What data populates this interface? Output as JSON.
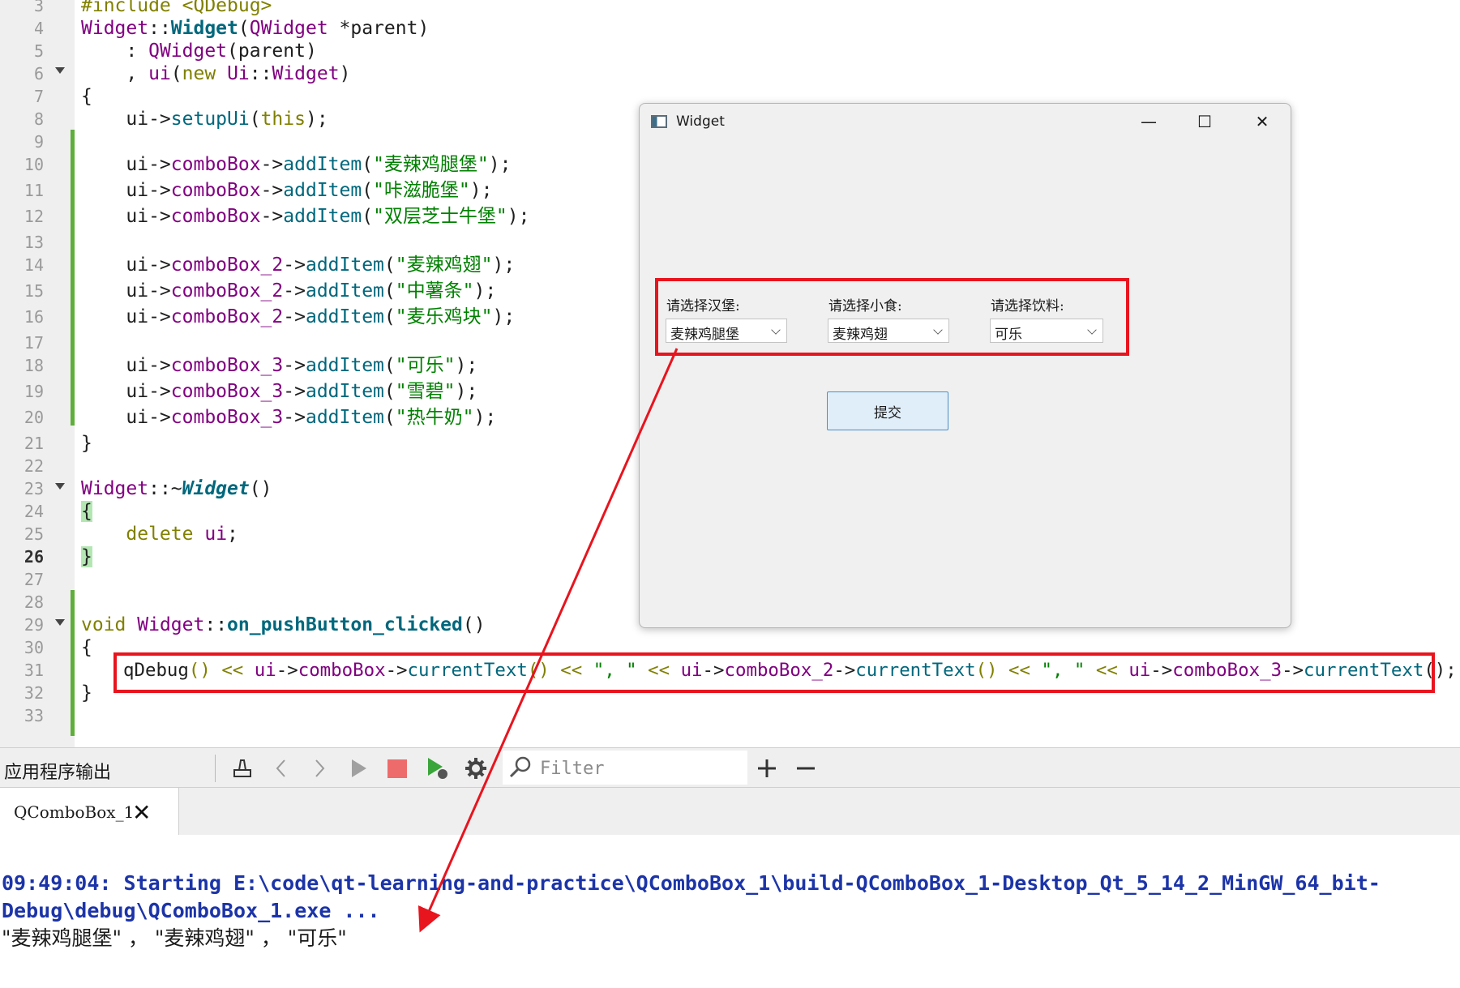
{
  "editor": {
    "line_numbers": [
      "3",
      "4",
      "5",
      "6",
      "7",
      "8",
      "9",
      "10",
      "11",
      "12",
      "13",
      "14",
      "15",
      "16",
      "17",
      "18",
      "19",
      "20",
      "21",
      "22",
      "23",
      "24",
      "25",
      "26",
      "27",
      "28",
      "29",
      "30",
      "31",
      "32",
      "33"
    ],
    "current_line": "26",
    "code": {
      "l3": "#include <QDebug>",
      "l4_a": "Widget",
      "l4_b": "::",
      "l4_c": "Widget",
      "l4_d": "(",
      "l4_e": "QWidget",
      "l4_f": " *parent)",
      "l5_a": "    : ",
      "l5_b": "QWidget",
      "l5_c": "(parent)",
      "l6_a": "    , ",
      "l6_b": "ui",
      "l6_c": "(",
      "l6_d": "new",
      "l6_e": " ",
      "l6_f": "Ui",
      "l6_g": "::",
      "l6_h": "Widget",
      "l6_i": ")",
      "l7": "{",
      "l8_a": "    ui->",
      "l8_b": "setupUi",
      "l8_c": "(",
      "l8_d": "this",
      "l8_e": ");",
      "l10_a": "    ui->",
      "l10_b": "comboBox",
      "l10_c": "->",
      "l10_d": "addItem",
      "l10_e": "(",
      "l10_f": "\"麦辣鸡腿堡\"",
      "l10_g": ");",
      "l11_a": "    ui->",
      "l11_b": "comboBox",
      "l11_c": "->",
      "l11_d": "addItem",
      "l11_e": "(",
      "l11_f": "\"咔滋脆堡\"",
      "l11_g": ");",
      "l12_a": "    ui->",
      "l12_b": "comboBox",
      "l12_c": "->",
      "l12_d": "addItem",
      "l12_e": "(",
      "l12_f": "\"双层芝士牛堡\"",
      "l12_g": ");",
      "l14_a": "    ui->",
      "l14_b": "comboBox_2",
      "l14_c": "->",
      "l14_d": "addItem",
      "l14_e": "(",
      "l14_f": "\"麦辣鸡翅\"",
      "l14_g": ");",
      "l15_a": "    ui->",
      "l15_b": "comboBox_2",
      "l15_c": "->",
      "l15_d": "addItem",
      "l15_e": "(",
      "l15_f": "\"中薯条\"",
      "l15_g": ");",
      "l16_a": "    ui->",
      "l16_b": "comboBox_2",
      "l16_c": "->",
      "l16_d": "addItem",
      "l16_e": "(",
      "l16_f": "\"麦乐鸡块\"",
      "l16_g": ");",
      "l18_a": "    ui->",
      "l18_b": "comboBox_3",
      "l18_c": "->",
      "l18_d": "addItem",
      "l18_e": "(",
      "l18_f": "\"可乐\"",
      "l18_g": ");",
      "l19_a": "    ui->",
      "l19_b": "comboBox_3",
      "l19_c": "->",
      "l19_d": "addItem",
      "l19_e": "(",
      "l19_f": "\"雪碧\"",
      "l19_g": ");",
      "l20_a": "    ui->",
      "l20_b": "comboBox_3",
      "l20_c": "->",
      "l20_d": "addItem",
      "l20_e": "(",
      "l20_f": "\"热牛奶\"",
      "l20_g": ");",
      "l21": "}",
      "l23_a": "Widget",
      "l23_b": "::~",
      "l23_c": "Widget",
      "l23_d": "()",
      "l24": "{",
      "l25_a": "    ",
      "l25_b": "delete",
      "l25_c": " ",
      "l25_d": "ui",
      "l25_e": ";",
      "l26": "}",
      "l29_a": "void",
      "l29_b": " ",
      "l29_c": "Widget",
      "l29_d": "::",
      "l29_e": "on_pushButton_clicked",
      "l29_f": "()",
      "l30": "{",
      "l31_a": "qDebug",
      "l31_b": "() << ",
      "l31_c": "ui",
      "l31_d": "->",
      "l31_e": "comboBox",
      "l31_f": "->",
      "l31_g": "currentText",
      "l31_h": "() << ",
      "l31_i": "\", \"",
      "l31_j": " << ",
      "l31_k": "ui",
      "l31_l": "->",
      "l31_m": "comboBox_2",
      "l31_n": "->",
      "l31_o": "currentText",
      "l31_p": "() << ",
      "l31_q": "\", \"",
      "l31_r": " << ",
      "l31_s": "ui",
      "l31_t": "->",
      "l31_u": "comboBox_3",
      "l31_v": "->",
      "l31_w": "currentText",
      "l31_x": "();",
      "l32": "}"
    }
  },
  "widget_window": {
    "title": "Widget",
    "minimize_glyph": "—",
    "maximize_glyph": "☐",
    "close_glyph": "✕",
    "burger_label": "请选择汉堡:",
    "burger_value": "麦辣鸡腿堡",
    "snack_label": "请选择小食:",
    "snack_value": "麦辣鸡翅",
    "drink_label": "请选择饮料:",
    "drink_value": "可乐",
    "submit_label": "提交"
  },
  "output_panel": {
    "title": "应用程序输出",
    "filter_placeholder": "Filter",
    "tab_label": "QComboBox_1",
    "tab_close_glyph": "✕",
    "start_line_1": "09:49:04: Starting E:\\code\\qt-learning-and-practice\\QComboBox_1\\build-QComboBox_1-Desktop_Qt_5_14_2_MinGW_64_bit-",
    "start_line_2": "Debug\\debug\\QComboBox_1.exe ...",
    "result_line": "\"麦辣鸡腿堡\" ， \"麦辣鸡翅\" ， \"可乐\""
  },
  "icons": {
    "toolbar": [
      "clean-icon",
      "prev-icon",
      "next-icon",
      "run-icon",
      "stop-icon",
      "debug-run-icon",
      "settings-icon",
      "search-icon",
      "add-icon",
      "remove-icon"
    ]
  },
  "colors": {
    "highlight_red": "#e8141e",
    "keyword": "#808000",
    "type": "#800080",
    "function": "#00677c",
    "string": "#008000",
    "output_start": "#1c34a8"
  }
}
